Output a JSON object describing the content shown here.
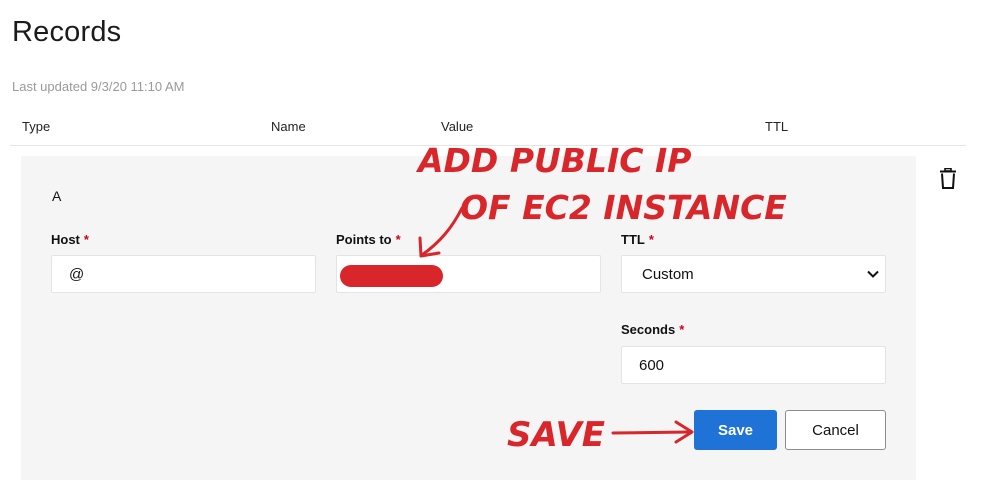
{
  "header": {
    "title": "Records",
    "last_updated": "Last updated 9/3/20 11:10 AM"
  },
  "columns": [
    "Type",
    "Name",
    "Value",
    "TTL"
  ],
  "record": {
    "type": "A",
    "host": {
      "label": "Host",
      "value": "@"
    },
    "points_to": {
      "label": "Points to",
      "value": ""
    },
    "ttl": {
      "label": "TTL",
      "selected": "Custom"
    },
    "seconds": {
      "label": "Seconds",
      "value": "600"
    },
    "required_mark": "*"
  },
  "buttons": {
    "save": "Save",
    "cancel": "Cancel"
  },
  "annotations": {
    "line1": "ADD PUBLIC IP",
    "line2": "OF EC2 INSTANCE",
    "save_note": "SAVE",
    "color": "#d8262a"
  },
  "colors": {
    "accent": "#1f73d6",
    "required": "#d0021b",
    "card_bg": "#f5f5f5"
  }
}
